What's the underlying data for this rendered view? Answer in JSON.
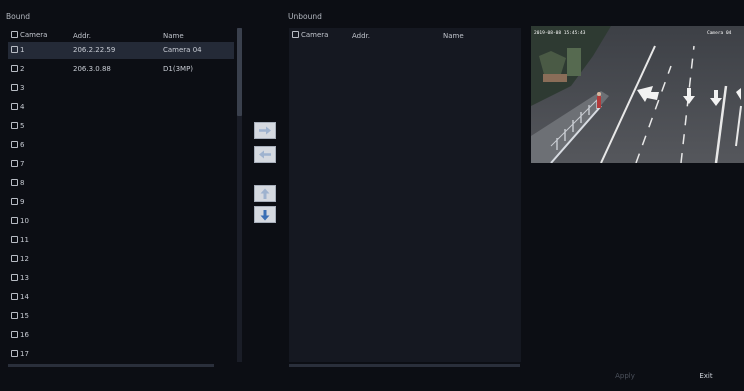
{
  "bound": {
    "title": "Bound",
    "columns": {
      "camera": "Camera",
      "addr": "Addr.",
      "name": "Name"
    },
    "rows": [
      {
        "camera": "1",
        "addr": "206.2.22.59",
        "name": "Camera 04",
        "selected": true
      },
      {
        "camera": "2",
        "addr": "206.3.0.88",
        "name": "D1(3MP)"
      },
      {
        "camera": "3",
        "addr": "",
        "name": ""
      },
      {
        "camera": "4",
        "addr": "",
        "name": ""
      },
      {
        "camera": "5",
        "addr": "",
        "name": ""
      },
      {
        "camera": "6",
        "addr": "",
        "name": ""
      },
      {
        "camera": "7",
        "addr": "",
        "name": ""
      },
      {
        "camera": "8",
        "addr": "",
        "name": ""
      },
      {
        "camera": "9",
        "addr": "",
        "name": ""
      },
      {
        "camera": "10",
        "addr": "",
        "name": ""
      },
      {
        "camera": "11",
        "addr": "",
        "name": ""
      },
      {
        "camera": "12",
        "addr": "",
        "name": ""
      },
      {
        "camera": "13",
        "addr": "",
        "name": ""
      },
      {
        "camera": "14",
        "addr": "",
        "name": ""
      },
      {
        "camera": "15",
        "addr": "",
        "name": ""
      },
      {
        "camera": "16",
        "addr": "",
        "name": ""
      },
      {
        "camera": "17",
        "addr": "",
        "name": ""
      }
    ]
  },
  "unbound": {
    "title": "Unbound",
    "columns": {
      "camera": "Camera",
      "addr": "Addr.",
      "name": "Name"
    }
  },
  "controls": {
    "move_right": "arrow-right-icon",
    "move_left": "arrow-left-icon",
    "move_up": "arrow-up-icon",
    "move_down": "arrow-down-icon"
  },
  "preview": {
    "overlay_date": "2019-08-08 15:45:43",
    "overlay_label": "Camera 04"
  },
  "buttons": {
    "apply": "Apply",
    "exit": "Exit"
  },
  "colors": {
    "background": "#0c0e14",
    "panel": "#151821",
    "selected_row": "#242a37",
    "button_face": "#d5d9e0",
    "arrow_active": "#3a6fb5",
    "arrow_inactive": "#9fb3cf"
  }
}
